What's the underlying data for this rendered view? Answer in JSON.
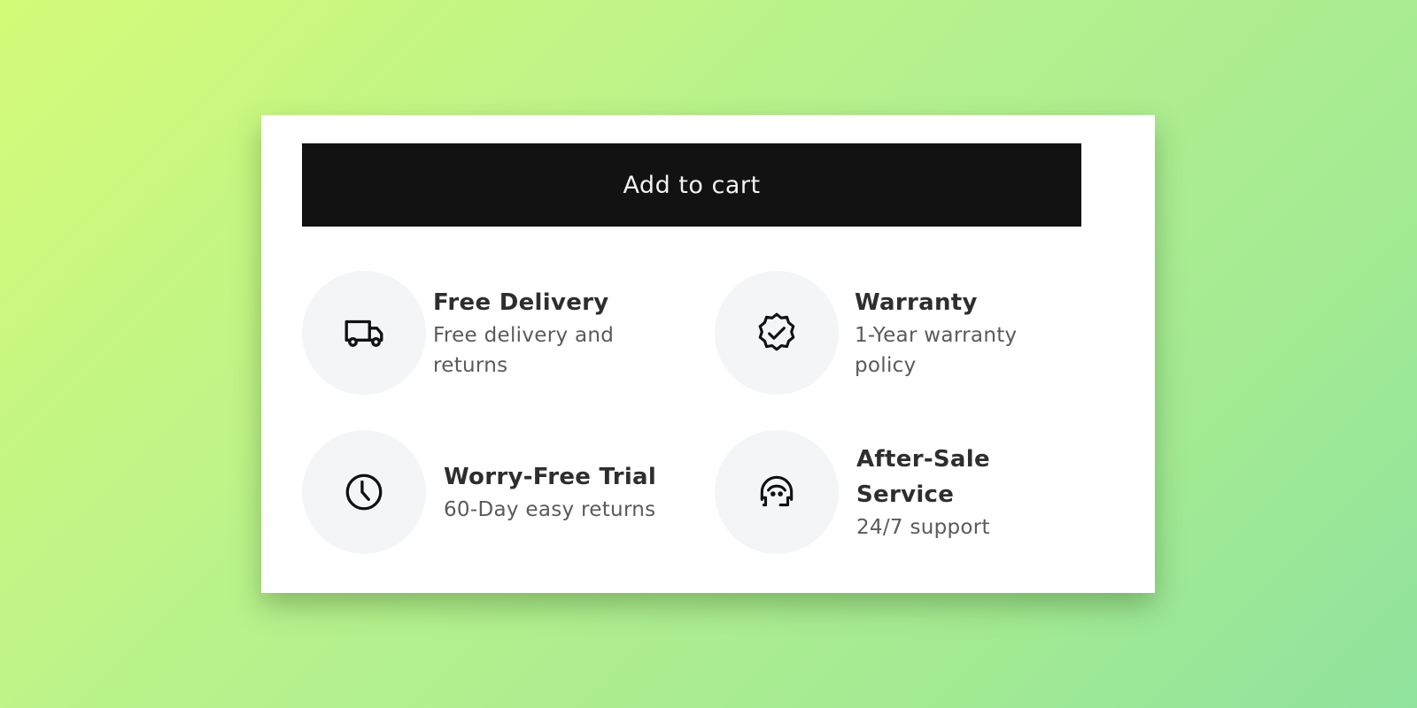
{
  "cart": {
    "button_label": "Add to cart"
  },
  "features": [
    {
      "icon": "truck-icon",
      "title": "Free Delivery",
      "description": "Free delivery and returns"
    },
    {
      "icon": "badge-check-icon",
      "title": "Warranty",
      "description": "1-Year warranty policy"
    },
    {
      "icon": "clock-icon",
      "title": "Worry-Free Trial",
      "description": "60-Day easy returns"
    },
    {
      "icon": "headset-support-icon",
      "title": "After-Sale Service",
      "description": "24/7 support"
    }
  ],
  "colors": {
    "button_bg": "#121212",
    "button_text": "#f2f2f2",
    "icon_circle_bg": "#f4f5f7",
    "card_bg": "#ffffff"
  }
}
